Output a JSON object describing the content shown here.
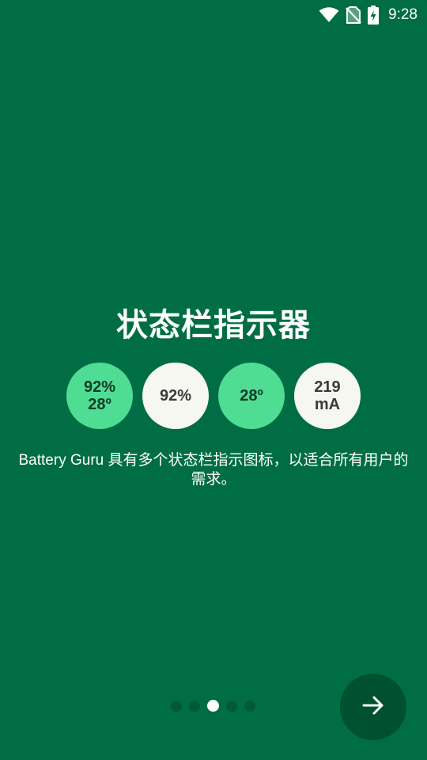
{
  "status_bar": {
    "time": "9:28",
    "icons": [
      "wifi-icon",
      "no-sim-icon",
      "battery-charging-icon"
    ]
  },
  "onboarding": {
    "title": "状态栏指示器",
    "indicators": [
      {
        "line1": "92%",
        "line2": "28º",
        "style": "green"
      },
      {
        "line1": "92%",
        "line2": "",
        "style": "white"
      },
      {
        "line1": "28º",
        "line2": "",
        "style": "green"
      },
      {
        "line1": "219",
        "line2": "mA",
        "style": "white"
      }
    ],
    "description": "Battery Guru 具有多个状态栏指示图标，以适合所有用户的需求。"
  },
  "pager": {
    "total_pages": 5,
    "current_page": 3
  },
  "next_button": {
    "icon": "arrow-right-icon"
  },
  "colors": {
    "background": "#006d45",
    "indicator_green": "#4fdd94",
    "indicator_white": "#f7f7f2",
    "button": "#00512f"
  }
}
